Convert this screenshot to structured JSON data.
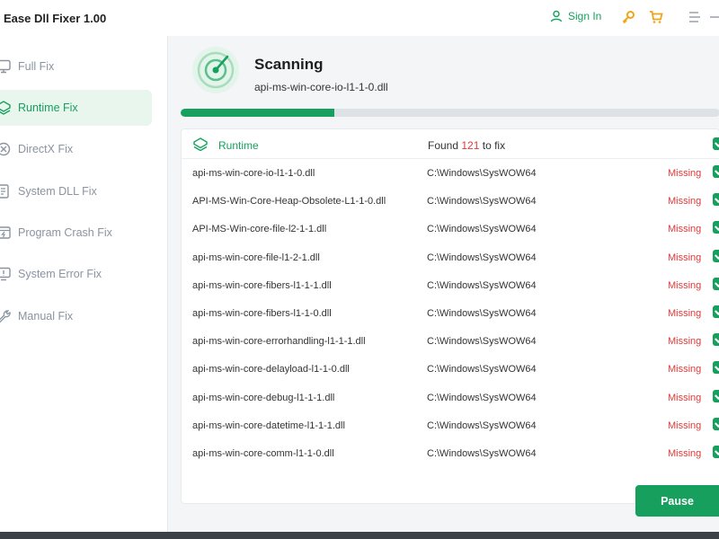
{
  "app": {
    "title": "Ease Dll Fixer  1.00"
  },
  "header": {
    "sign_in": "Sign In"
  },
  "sidebar": {
    "items": [
      {
        "label": "Full Fix",
        "active": false
      },
      {
        "label": "Runtime Fix",
        "active": true
      },
      {
        "label": "DirectX Fix",
        "active": false
      },
      {
        "label": "System DLL Fix",
        "active": false
      },
      {
        "label": "Program Crash Fix",
        "active": false
      },
      {
        "label": "System Error Fix",
        "active": false
      },
      {
        "label": "Manual Fix",
        "active": false
      }
    ]
  },
  "scan": {
    "title": "Scanning",
    "current_file": "api-ms-win-core-io-l1-1-0.dll",
    "progress": 0.285
  },
  "table": {
    "category": "Runtime",
    "found_prefix": "Found",
    "found_count": "121",
    "found_suffix": "to fix",
    "rows": [
      {
        "name": "api-ms-win-core-io-l1-1-0.dll",
        "path": "C:\\Windows\\SysWOW64",
        "status": "Missing"
      },
      {
        "name": "API-MS-Win-Core-Heap-Obsolete-L1-1-0.dll",
        "path": "C:\\Windows\\SysWOW64",
        "status": "Missing"
      },
      {
        "name": "API-MS-Win-core-file-l2-1-1.dll",
        "path": "C:\\Windows\\SysWOW64",
        "status": "Missing"
      },
      {
        "name": "api-ms-win-core-file-l1-2-1.dll",
        "path": "C:\\Windows\\SysWOW64",
        "status": "Missing"
      },
      {
        "name": "api-ms-win-core-fibers-l1-1-1.dll",
        "path": "C:\\Windows\\SysWOW64",
        "status": "Missing"
      },
      {
        "name": "api-ms-win-core-fibers-l1-1-0.dll",
        "path": "C:\\Windows\\SysWOW64",
        "status": "Missing"
      },
      {
        "name": "api-ms-win-core-errorhandling-l1-1-1.dll",
        "path": "C:\\Windows\\SysWOW64",
        "status": "Missing"
      },
      {
        "name": "api-ms-win-core-delayload-l1-1-0.dll",
        "path": "C:\\Windows\\SysWOW64",
        "status": "Missing"
      },
      {
        "name": "api-ms-win-core-debug-l1-1-1.dll",
        "path": "C:\\Windows\\SysWOW64",
        "status": "Missing"
      },
      {
        "name": "api-ms-win-core-datetime-l1-1-1.dll",
        "path": "C:\\Windows\\SysWOW64",
        "status": "Missing"
      },
      {
        "name": "api-ms-win-core-comm-l1-1-0.dll",
        "path": "C:\\Windows\\SysWOW64",
        "status": "Missing"
      }
    ]
  },
  "actions": {
    "pause": "Pause"
  },
  "colors": {
    "accent": "#17a05d",
    "missing": "#e03a3a",
    "active_bg": "#e8f6ee"
  },
  "icons": [
    "user-icon",
    "key-icon",
    "cart-icon",
    "menu-icon",
    "minimize-icon",
    "radar-icon",
    "shield-icon"
  ]
}
